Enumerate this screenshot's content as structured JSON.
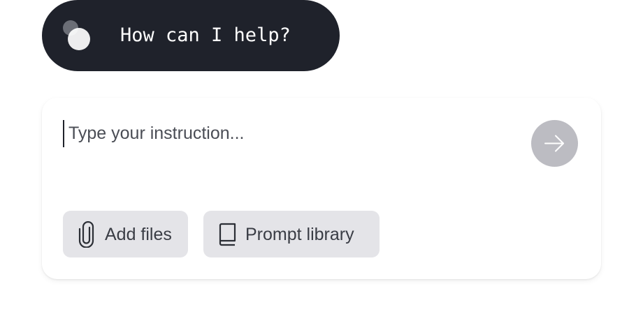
{
  "header": {
    "greeting": "How can I help?",
    "logo_icon": "overlapping-circles-logo"
  },
  "composer": {
    "input_value": "",
    "input_placeholder": "Type your instruction...",
    "send_icon": "arrow-right-icon",
    "actions": [
      {
        "label": "Add files",
        "icon": "paperclip-icon"
      },
      {
        "label": "Prompt library",
        "icon": "book-icon"
      }
    ]
  },
  "colors": {
    "pill_background": "#1f222b",
    "pill_text": "#ffffff",
    "send_button": "#bcbcc2",
    "chip_background": "#e4e4e8",
    "chip_text": "#3a3d45"
  }
}
